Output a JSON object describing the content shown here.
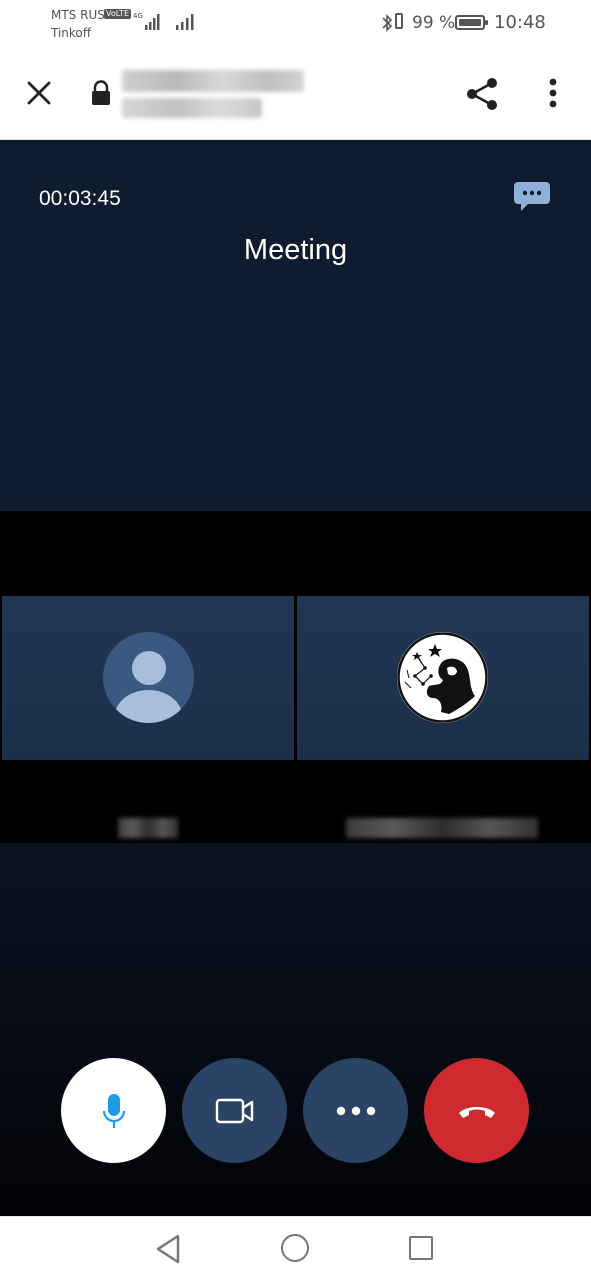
{
  "status_bar": {
    "carrier": "MTS RUS",
    "volte": "VoLTE",
    "carrier_sub": "Tinkoff",
    "network": "4G",
    "battery_percent": "99 %",
    "battery_level": 0.99,
    "time": "10:48"
  },
  "browser": {
    "icons": [
      "close-icon",
      "lock-icon",
      "share-icon",
      "more-vert-icon"
    ]
  },
  "meeting": {
    "timer": "00:03:45",
    "title": "Meeting",
    "participants": [
      {
        "avatar": "default-user-icon"
      },
      {
        "avatar": "photo"
      }
    ]
  },
  "controls": {
    "colors": {
      "mic": "#ffffff",
      "camera": "#2b4466",
      "more": "#2b4466",
      "hangup": "#d02a31",
      "accent": "#1e9be6"
    },
    "icons": [
      "microphone-icon",
      "video-camera-icon",
      "more-horiz-icon",
      "hang-up-icon"
    ]
  },
  "nav": {
    "icons": [
      "back-icon",
      "home-icon",
      "recents-icon"
    ]
  }
}
